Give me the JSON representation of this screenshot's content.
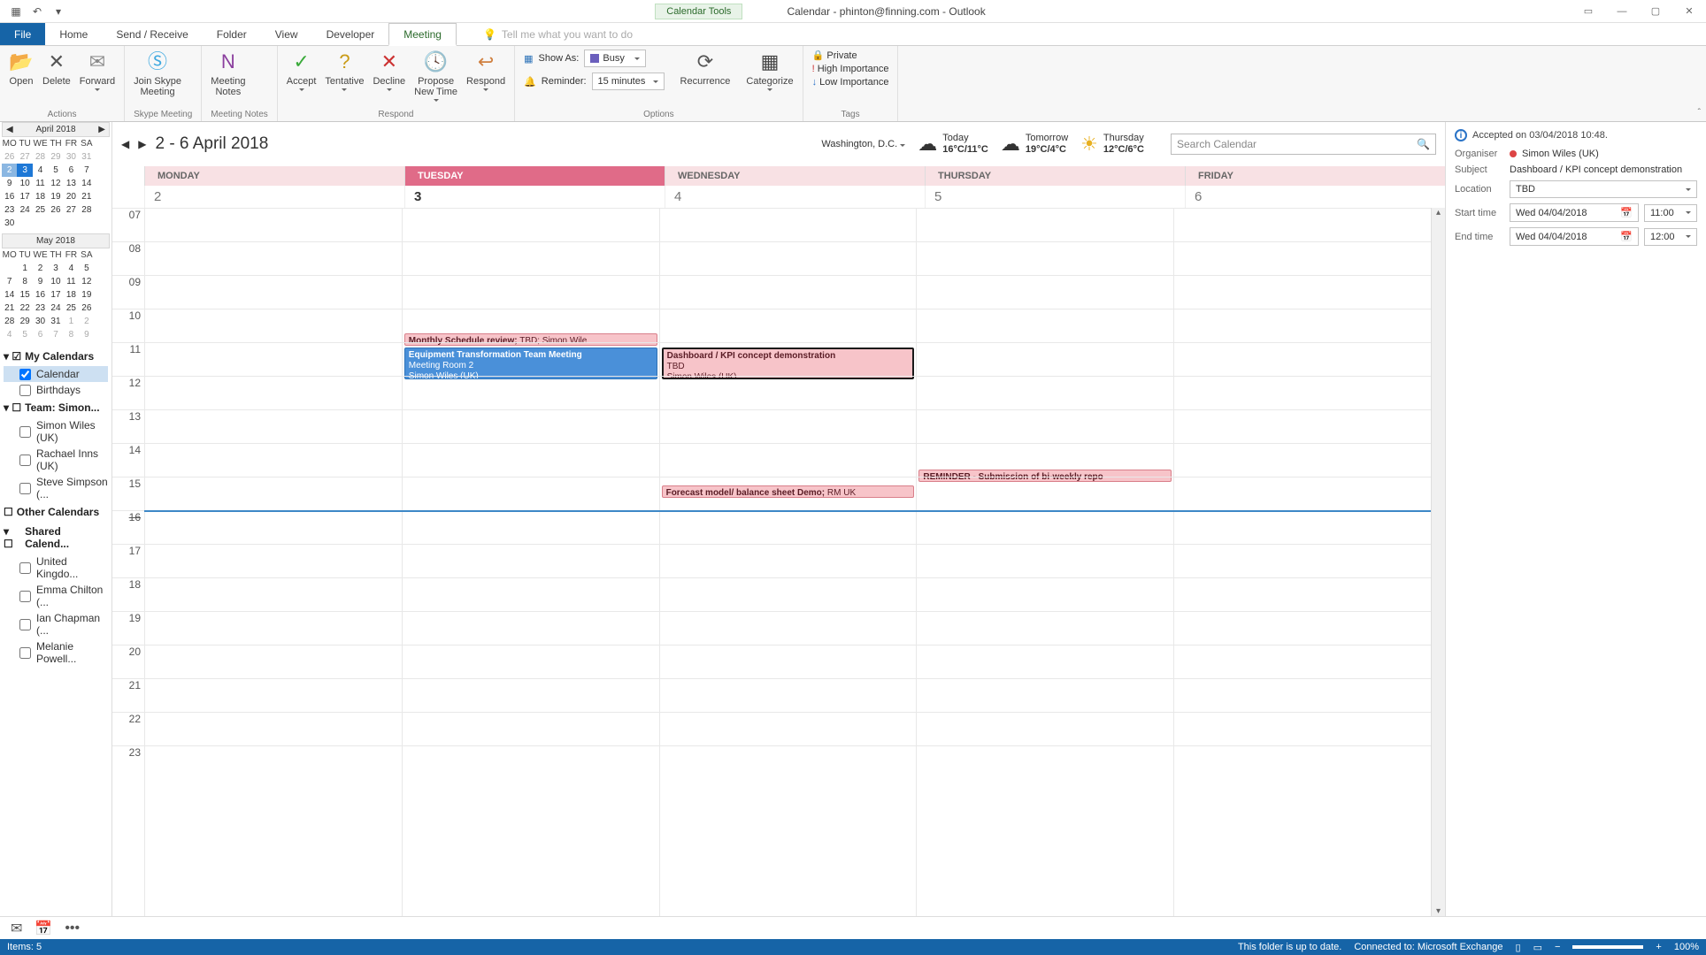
{
  "title": "Calendar - phinton@finning.com - Outlook",
  "calendar_tools": "Calendar Tools",
  "tabs": {
    "file": "File",
    "home": "Home",
    "sendreceive": "Send / Receive",
    "folder": "Folder",
    "view": "View",
    "developer": "Developer",
    "meeting": "Meeting"
  },
  "tell_me_placeholder": "Tell me what you want to do",
  "ribbon": {
    "actions": {
      "open": "Open",
      "delete": "Delete",
      "forward": "Forward",
      "label": "Actions"
    },
    "skype": {
      "btn": "Join Skype\nMeeting",
      "label": "Skype Meeting"
    },
    "notes": {
      "btn": "Meeting\nNotes",
      "label": "Meeting Notes"
    },
    "respond": {
      "accept": "Accept",
      "tentative": "Tentative",
      "decline": "Decline",
      "propose": "Propose\nNew Time",
      "respond": "Respond",
      "label": "Respond"
    },
    "options": {
      "show_as": "Show As:",
      "show_as_val": "Busy",
      "reminder": "Reminder:",
      "reminder_val": "15 minutes",
      "recurrence": "Recurrence",
      "categorize": "Categorize",
      "label": "Options"
    },
    "tags": {
      "private": "Private",
      "high": "High Importance",
      "low": "Low Importance",
      "label": "Tags"
    }
  },
  "mini_april": {
    "title": "April 2018",
    "dow": [
      "MO",
      "TU",
      "WE",
      "TH",
      "FR",
      "SA"
    ],
    "rows": [
      [
        "26",
        "27",
        "28",
        "29",
        "30",
        "31"
      ],
      [
        "2",
        "3",
        "4",
        "5",
        "6",
        "7"
      ],
      [
        "9",
        "10",
        "11",
        "12",
        "13",
        "14"
      ],
      [
        "16",
        "17",
        "18",
        "19",
        "20",
        "21"
      ],
      [
        "23",
        "24",
        "25",
        "26",
        "27",
        "28"
      ],
      [
        "30",
        "",
        "",
        "",
        "",
        ""
      ]
    ]
  },
  "mini_may": {
    "title": "May 2018",
    "rows": [
      [
        "",
        "1",
        "2",
        "3",
        "4",
        "5"
      ],
      [
        "7",
        "8",
        "9",
        "10",
        "11",
        "12"
      ],
      [
        "14",
        "15",
        "16",
        "17",
        "18",
        "19"
      ],
      [
        "21",
        "22",
        "23",
        "24",
        "25",
        "26"
      ],
      [
        "28",
        "29",
        "30",
        "31",
        "1",
        "2"
      ],
      [
        "4",
        "5",
        "6",
        "7",
        "8",
        "9"
      ]
    ]
  },
  "cal_groups": {
    "my": "My Calendars",
    "calendar": "Calendar",
    "birthdays": "Birthdays",
    "team": "Team: Simon...",
    "simon": "Simon Wiles (UK)",
    "rachael": "Rachael Inns (UK)",
    "steve": "Steve Simpson (...",
    "other": "Other Calendars",
    "shared": "Shared Calend...",
    "uk": "United Kingdo...",
    "emma": "Emma Chilton (...",
    "ian": "Ian Chapman (...",
    "melanie": "Melanie Powell..."
  },
  "date_range": "2 - 6 April 2018",
  "location": "Washington, D.C.",
  "weather": [
    {
      "lab": "Today",
      "temp": "16°C/11°C"
    },
    {
      "lab": "Tomorrow",
      "temp": "19°C/4°C"
    },
    {
      "lab": "Thursday",
      "temp": "12°C/6°C"
    }
  ],
  "search_placeholder": "Search Calendar",
  "days": [
    "MONDAY",
    "TUESDAY",
    "WEDNESDAY",
    "THURSDAY",
    "FRIDAY"
  ],
  "daynums": [
    "2",
    "3",
    "4",
    "5",
    "6"
  ],
  "hours": [
    "07",
    "08",
    "09",
    "10",
    "11",
    "12",
    "13",
    "14",
    "15",
    "16",
    "17",
    "18",
    "19",
    "20",
    "21",
    "22",
    "23"
  ],
  "events": {
    "monthly": {
      "title": "Monthly Schedule review;",
      "sub": "TBD; Simon Wile"
    },
    "equip": {
      "title": "Equipment Transformation Team Meeting",
      "loc": "Meeting Room 2",
      "org": "Simon Wiles (UK)"
    },
    "dash": {
      "title": "Dashboard / KPI concept demonstration",
      "loc": "TBD",
      "org": "Simon Wiles (UK)"
    },
    "forecast": {
      "title": "Forecast model/ balance sheet Demo;",
      "sub": "RM UK"
    },
    "reminder": {
      "title": "REMINDER - Submission of bi-weekly repo"
    }
  },
  "details": {
    "accepted": "Accepted on 03/04/2018 10:48.",
    "organiser_lab": "Organiser",
    "organiser": "Simon Wiles (UK)",
    "subject_lab": "Subject",
    "subject": "Dashboard / KPI concept demonstration",
    "location_lab": "Location",
    "location": "TBD",
    "start_lab": "Start time",
    "start_date": "Wed 04/04/2018",
    "start_time": "11:00",
    "end_lab": "End time",
    "end_date": "Wed 04/04/2018",
    "end_time": "12:00"
  },
  "status": {
    "items": "Items: 5",
    "uptodate": "This folder is up to date.",
    "connected": "Connected to: Microsoft Exchange",
    "zoom": "100%"
  },
  "now_label": "16"
}
